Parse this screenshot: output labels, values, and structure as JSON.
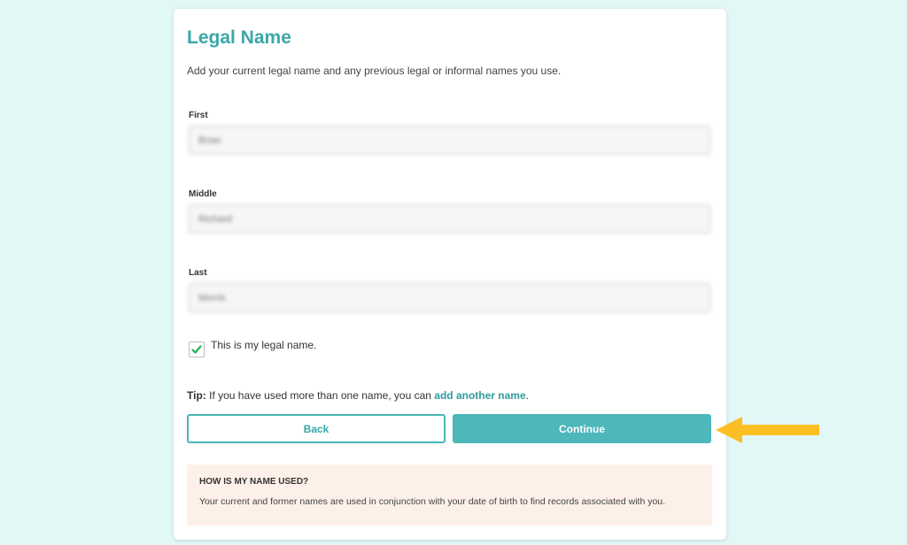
{
  "form": {
    "title": "Legal Name",
    "subtitle": "Add your current legal name and any previous legal or informal names you use.",
    "fields": {
      "first": {
        "label": "First",
        "value": "Brian"
      },
      "middle": {
        "label": "Middle",
        "value": "Richard"
      },
      "last": {
        "label": "Last",
        "value": "Morris"
      }
    },
    "legal_checkbox": {
      "label": "This is my legal name.",
      "checked": true
    },
    "tip": {
      "prefix": "Tip:",
      "text": " If you have used more than one name, you can ",
      "link": "add another name",
      "suffix": "."
    },
    "buttons": {
      "back": "Back",
      "continue": "Continue"
    },
    "info": {
      "title": "HOW IS MY NAME USED?",
      "text": "Your current and former names are used in conjunction with your date of birth to find records associated with you."
    }
  },
  "colors": {
    "page_background": "#e2f8f7",
    "accent": "#3aa8a8",
    "continue_button": "#4db7b9",
    "info_background": "#fdf0e8",
    "check_mark": "#22b04a",
    "annotation_arrow": "#fbbf24"
  },
  "icons": {
    "checkbox": "check-icon",
    "annotation": "arrow-left-icon"
  }
}
